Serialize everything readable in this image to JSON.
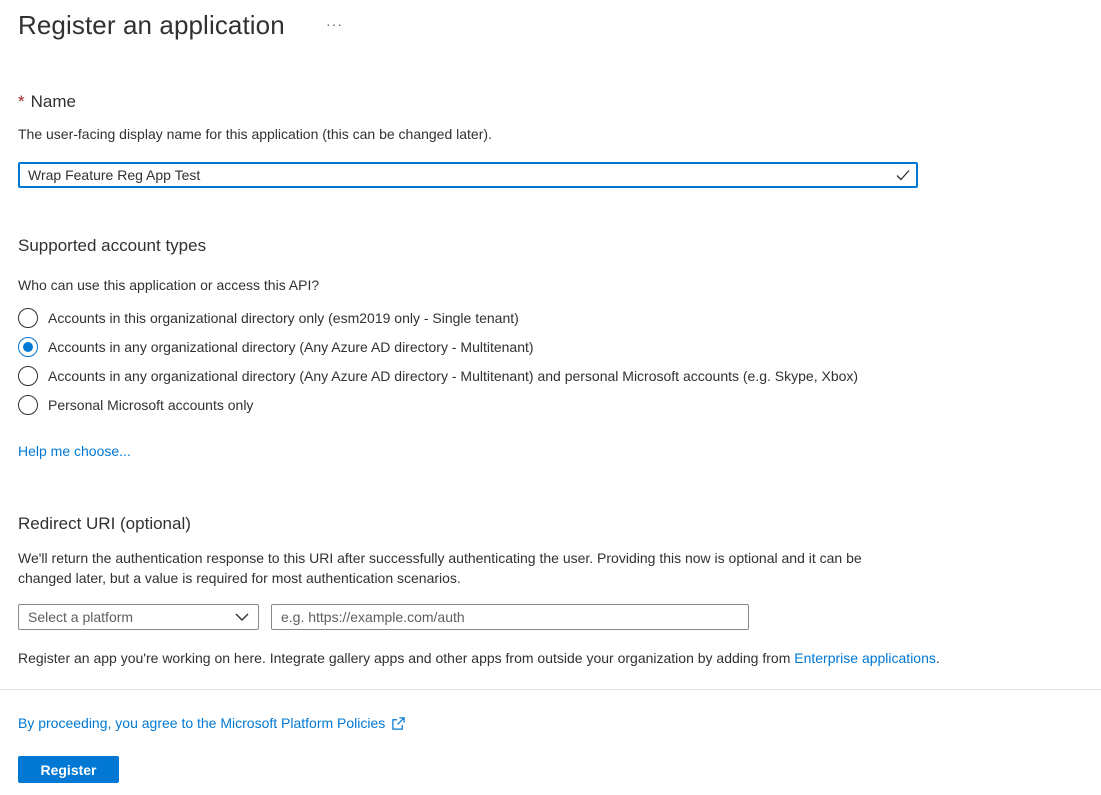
{
  "header": {
    "title": "Register an application",
    "more_label": "···"
  },
  "name_section": {
    "required_star": "*",
    "heading": "Name",
    "description": "The user-facing display name for this application (this can be changed later).",
    "input_value": "Wrap Feature Reg App Test",
    "valid_icon": "check-icon"
  },
  "account_types": {
    "heading": "Supported account types",
    "question": "Who can use this application or access this API?",
    "options": [
      {
        "label": "Accounts in this organizational directory only (esm2019 only - Single tenant)",
        "selected": false
      },
      {
        "label": "Accounts in any organizational directory (Any Azure AD directory - Multitenant)",
        "selected": true
      },
      {
        "label": "Accounts in any organizational directory (Any Azure AD directory - Multitenant) and personal Microsoft accounts (e.g. Skype, Xbox)",
        "selected": false
      },
      {
        "label": "Personal Microsoft accounts only",
        "selected": false
      }
    ],
    "help_link": "Help me choose..."
  },
  "redirect_uri": {
    "heading": "Redirect URI (optional)",
    "description_line1": "We'll return the authentication response to this URI after successfully authenticating the user. Providing this now is optional and it can be",
    "description_line2": "changed later, but a value is required for most authentication scenarios.",
    "platform_placeholder": "Select a platform",
    "uri_placeholder": "e.g. https://example.com/auth"
  },
  "footer_note": {
    "text": "Register an app you're working on here. Integrate gallery apps and other apps from outside your organization by adding from ",
    "link": "Enterprise applications",
    "suffix": "."
  },
  "policy": {
    "link_text": "By proceeding, you agree to the Microsoft Platform Policies",
    "icon": "external-link-icon"
  },
  "actions": {
    "register_label": "Register"
  },
  "colors": {
    "accent": "#0078d4",
    "text": "#323130",
    "required": "#a4262c",
    "border": "#8a8886",
    "divider": "#e1dfdd"
  }
}
